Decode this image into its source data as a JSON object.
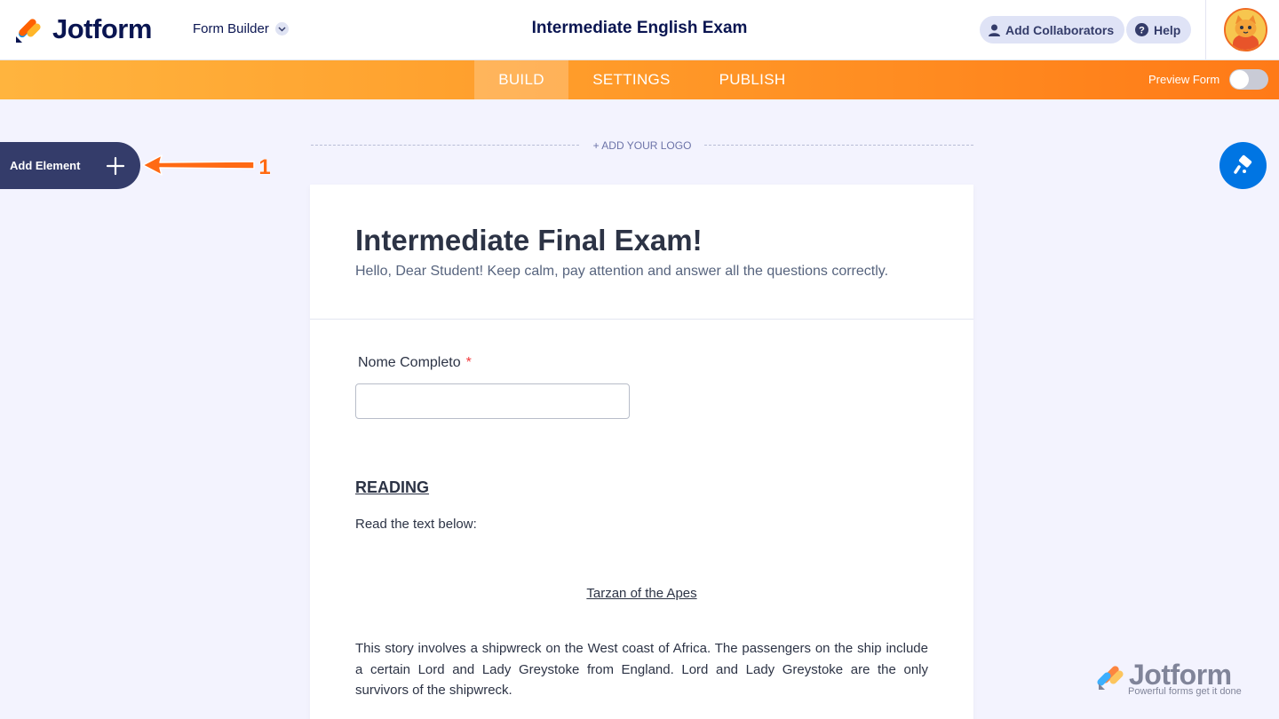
{
  "header": {
    "brand": "Jotform",
    "mode_label": "Form Builder",
    "form_title": "Intermediate English Exam",
    "add_collaborators": "Add Collaborators",
    "help": "Help"
  },
  "nav": {
    "tabs": [
      {
        "label": "BUILD",
        "active": true
      },
      {
        "label": "SETTINGS",
        "active": false
      },
      {
        "label": "PUBLISH",
        "active": false
      }
    ],
    "preview_form": "Preview Form",
    "preview_enabled": false
  },
  "sidebar": {
    "add_element": "Add Element",
    "callout_number": "1"
  },
  "canvas": {
    "add_logo": "+ ADD YOUR LOGO"
  },
  "form": {
    "heading": "Intermediate Final Exam!",
    "subheading": "Hello, Dear Student! Keep calm, pay attention and answer all the questions correctly.",
    "fields": [
      {
        "label": "Nome Completo",
        "required_mark": "*",
        "value": ""
      }
    ],
    "reading_heading": "READING",
    "reading_instruction": "Read the text below:",
    "story_title": "Tarzan of the Apes",
    "story_text": "This story involves a shipwreck on the West coast of Africa. The passengers on the ship include a certain Lord and Lady Greystoke from England. Lord and Lady Greystoke are the only survivors of the shipwreck."
  },
  "watermark": {
    "brand": "Jotform",
    "tagline": "Powerful forms get it done"
  },
  "colors": {
    "brand_navy": "#0a1551",
    "nav_orange_start": "#ffb43e",
    "nav_orange_end": "#ff7a17",
    "designer_blue": "#0075e3",
    "add_element_bg": "#343c6a",
    "required_red": "#f23a3c"
  }
}
